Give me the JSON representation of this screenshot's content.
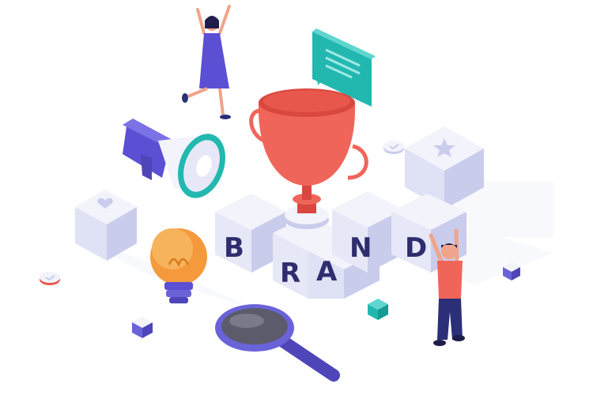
{
  "scene": {
    "letters": [
      "B",
      "R",
      "A",
      "N",
      "D"
    ],
    "colors": {
      "cube_top": "#f2f3fb",
      "cube_left": "#dfe1f4",
      "cube_right": "#c9cceb",
      "letter": "#2f2d6e",
      "trophy": "#f0655a",
      "trophy_dark": "#d9473f",
      "teal": "#22b8b0",
      "megaphone_body": "#5b4fd4",
      "bulb": "#f59a3c",
      "magnifier": "#6a63d8",
      "person_shirt": "#f0655a",
      "person_pants": "#2a2f78",
      "woman_dress": "#5b4fd4"
    },
    "icons": [
      "trophy-icon",
      "megaphone-icon",
      "speech-bubble-icon",
      "light-bulb-icon",
      "magnifier-icon",
      "heart-icon",
      "star-icon",
      "check-icon"
    ]
  }
}
